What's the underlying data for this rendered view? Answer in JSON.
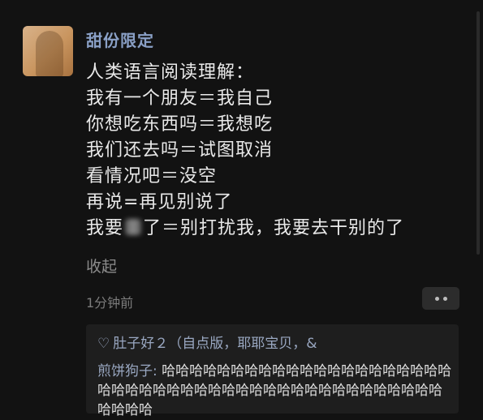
{
  "post": {
    "username": "甜份限定",
    "lines": [
      "人类语言阅读理解：",
      "我有一个朋友＝我自己",
      "你想吃东西吗＝我想吃",
      "我们还去吗＝试图取消",
      "看情况吧＝没空",
      "再说=再见别说了"
    ],
    "last_line_before": "我要",
    "last_line_after": "了＝别打扰我，我要去干别的了",
    "collapse_label": "收起",
    "time": "1分钟前"
  },
  "replies": {
    "likes_text": "肚子好２（自点版，耶耶宝贝，&",
    "reply_name": "煎饼狗子:",
    "reply_text": " 哈哈哈哈哈哈哈哈哈哈哈哈哈哈哈哈哈哈哈哈哈哈哈哈哈哈哈哈哈哈哈哈哈哈哈哈哈哈哈哈哈哈哈哈哈哈哈哈哈哈"
  },
  "icons": {
    "heart": "heart-outline-icon",
    "more": "more-dots-icon"
  },
  "colors": {
    "background": "#121212",
    "username": "#8aa0c6",
    "text": "#e9e9e9",
    "muted": "#8c8c8c"
  }
}
